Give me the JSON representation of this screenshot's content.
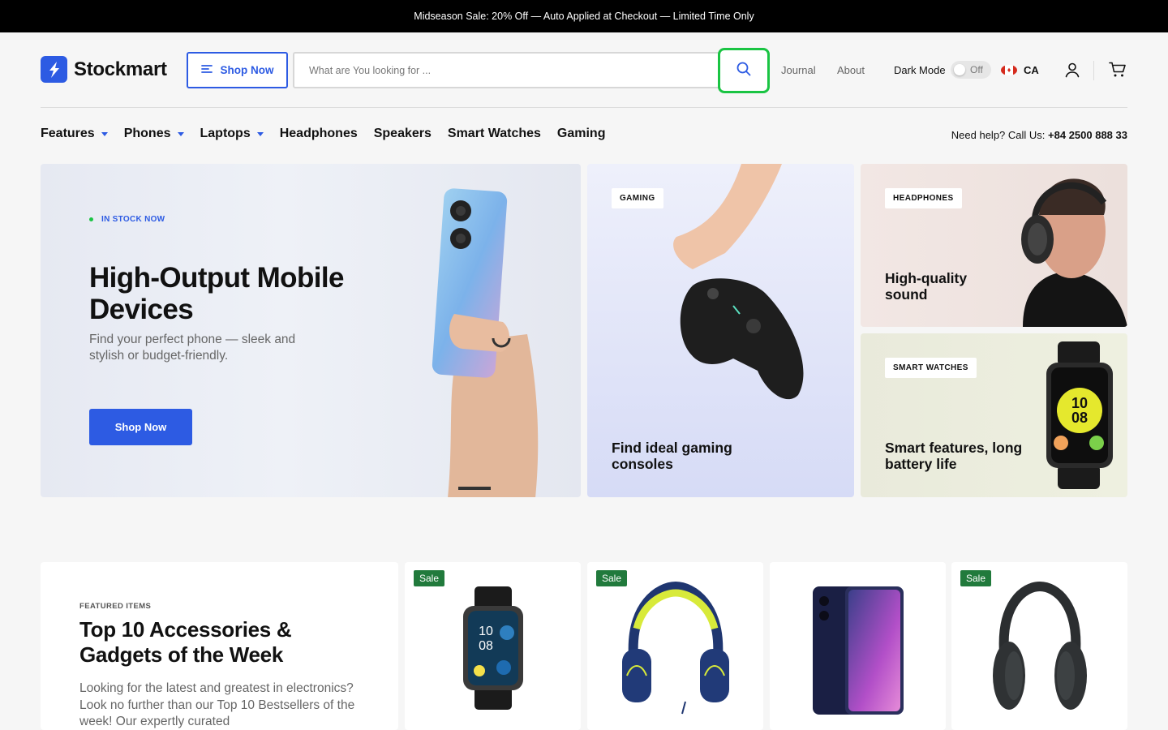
{
  "announcement": "Midseason Sale: 20% Off — Auto Applied at Checkout — Limited Time Only",
  "header": {
    "brand": "Stockmart",
    "shop_button": "Shop Now",
    "search_placeholder": "What are You looking for ...",
    "journal": "Journal",
    "about": "About",
    "dark_mode_label": "Dark Mode",
    "dark_mode_state": "Off",
    "country": "CA"
  },
  "categories": [
    "Features",
    "Phones",
    "Laptops",
    "Headphones",
    "Speakers",
    "Smart Watches",
    "Gaming"
  ],
  "help": {
    "text": "Need help? Call Us:",
    "phone": "+84 2500 888 33"
  },
  "hero": {
    "badge": "IN STOCK NOW",
    "title": "High-Output Mobile Devices",
    "subtitle": "Find your perfect phone — sleek and stylish or budget-friendly.",
    "button": "Shop Now"
  },
  "promos": {
    "gaming": {
      "tag": "GAMING",
      "title": "Find ideal gaming consoles"
    },
    "headphones": {
      "tag": "HEADPHONES",
      "title": "High-quality sound"
    },
    "watches": {
      "tag": "SMART WATCHES",
      "title": "Smart features, long battery life"
    }
  },
  "featured": {
    "overline": "FEATURED ITEMS",
    "title": "Top 10 Accessories & Gadgets of the Week",
    "description": "Looking for the latest and greatest in electronics? Look no further than our Top 10 Bestsellers of the week! Our expertly curated"
  },
  "products": [
    {
      "badge": "Sale",
      "icon": "smartwatch-image"
    },
    {
      "badge": "Sale",
      "icon": "headphones-image"
    },
    {
      "badge": "",
      "icon": "smartphone-image"
    },
    {
      "badge": "Sale",
      "icon": "over-ear-headphones-image"
    }
  ],
  "colors": {
    "accent": "#2d5be3",
    "sale": "#217a3c",
    "highlight": "#1ac443",
    "announcement_bg": "#000000"
  }
}
